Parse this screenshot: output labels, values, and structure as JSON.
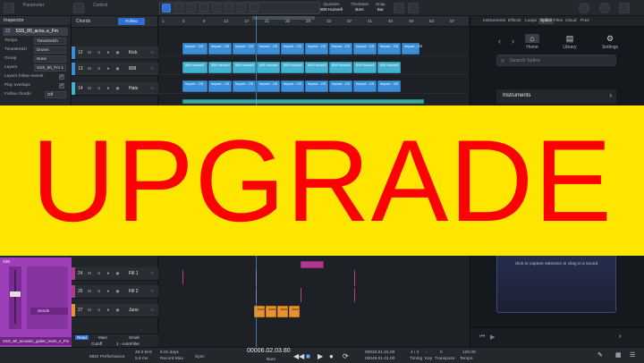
{
  "toolbar": {
    "parameter_label": "Parameter",
    "control_label": "Control",
    "quantize": {
      "label": "Quantize",
      "value": "808 Hazwell"
    },
    "timebase": {
      "label": "Timebase",
      "value": "Bars"
    },
    "snap": {
      "label": "Snap",
      "value": "Bar"
    }
  },
  "inspector": {
    "title": "Inspector",
    "track_number": "22",
    "track_name": "SSS_80_acou..e_Fm",
    "rows": [
      {
        "label": "Tempo",
        "value": "Timestretch"
      },
      {
        "label": "Timestretch",
        "value": "Drums"
      },
      {
        "label": "Group",
        "value": "None"
      },
      {
        "label": "Layers",
        "value": "SSS_80_Fm 1"
      }
    ],
    "checks": [
      {
        "label": "Layers follow events",
        "checked": "✓"
      },
      {
        "label": "Play overlaps",
        "checked": "✓"
      }
    ],
    "follow_chords": {
      "label": "Follow chords",
      "value": "Off"
    },
    "fader_db": "0dB",
    "sends_label": "Sends",
    "footer_label": "SSS_80_acoustic_guitar_ream_e_Fm"
  },
  "tracklist": {
    "chords_label": "Chords",
    "follow_label": "Follow",
    "tracks": [
      {
        "num": "12",
        "name": "Kick",
        "color": "#3b8fd8"
      },
      {
        "num": "13",
        "name": "808",
        "color": "#3b8fd8"
      },
      {
        "num": "14",
        "name": "Hats",
        "color": "#43b1cf"
      },
      {
        "num": "24",
        "name": "Fill 1",
        "color": "#b0388f"
      },
      {
        "num": "25",
        "name": "Fill 2",
        "color": "#b0388f"
      },
      {
        "num": "27",
        "name": "Juno",
        "color": "#e7922f"
      }
    ],
    "bottom": {
      "cutoff": "Cutoff",
      "autofilter": "1 - AutoFilter",
      "small": "Small",
      "main": "Main",
      "read": "Read"
    }
  },
  "ruler": {
    "ticks": [
      "1",
      "5",
      "9",
      "13",
      "17",
      "21",
      "25",
      "29",
      "33",
      "37",
      "41",
      "45",
      "49",
      "53",
      "57"
    ]
  },
  "clips": {
    "kick": "Impact - OS",
    "bass": "808 Hazwell",
    "juno": "Juno"
  },
  "rightpanel": {
    "tabs": [
      "Instruments",
      "Effects",
      "Loops",
      "Splice",
      "Files",
      "Cloud",
      "Pool"
    ],
    "active_tab": "Splice",
    "nav": [
      {
        "label": "Home",
        "icon": "⌂"
      },
      {
        "label": "Library",
        "icon": "▤"
      },
      {
        "label": "Settings",
        "icon": "⚙"
      }
    ],
    "search_placeholder": "Search Splice",
    "instruments_label": "Instruments",
    "drop_text": "click to capture selection or drag in a sound"
  },
  "transport": {
    "midi": "MIDI",
    "performance": "Performance",
    "sample_rate": "48.0 kHz",
    "latency": "5.8 ms",
    "days": "5.01 days",
    "record_max": "Record Max",
    "sync": "Sync",
    "position": "00006.02.03.80",
    "position_unit": "Bars",
    "loop_start": "00033.01.01.00",
    "loop_end": "00049.01.01.00",
    "signature": "4 / 4",
    "timing_label": "Timing",
    "key_label": "Key",
    "key_value": "-",
    "transpose_value": "0",
    "transpose_label": "Transpose",
    "tempo_value": "120.00",
    "tempo_label": "Tempo"
  },
  "banner": {
    "text": "UPGRADE",
    "color": "#ff0000",
    "background": "#ffe600"
  }
}
